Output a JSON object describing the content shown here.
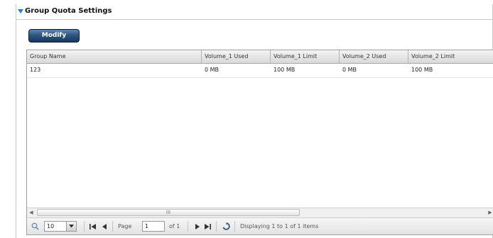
{
  "section": {
    "title": "Group Quota Settings"
  },
  "toolbar": {
    "modify_label": "Modify"
  },
  "table": {
    "columns": [
      "Group Name",
      "Volume_1  Used",
      "Volume_1  Limit",
      "Volume_2  Used",
      "Volume_2  Limit"
    ],
    "rows": [
      [
        "123",
        "0 MB",
        "100 MB",
        "0 MB",
        "100 MB"
      ]
    ]
  },
  "scrollbar": {
    "grip_label": "III"
  },
  "pager": {
    "page_size": "10",
    "page_label": "Page",
    "page_value": "1",
    "of_label": "of 1",
    "status": "Displaying 1 to 1 of 1 items"
  },
  "colors": {
    "accent": "#1d7fd6",
    "button": "#2c5580"
  }
}
